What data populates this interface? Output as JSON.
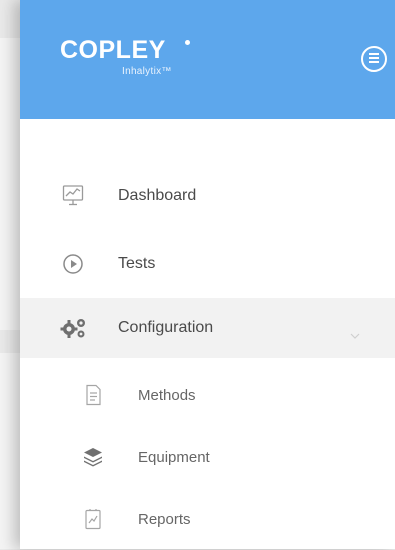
{
  "header": {
    "logo_title": "COPLEY",
    "logo_subtitle": "Inhalytix™"
  },
  "nav": {
    "items": [
      {
        "label": "Dashboard",
        "icon": "dashboard-chart-icon"
      },
      {
        "label": "Tests",
        "icon": "play-circle-icon"
      },
      {
        "label": "Configuration",
        "icon": "gears-icon",
        "expanded": true
      }
    ],
    "subitems": [
      {
        "label": "Methods",
        "icon": "document-icon"
      },
      {
        "label": "Equipment",
        "icon": "layers-icon"
      },
      {
        "label": "Reports",
        "icon": "report-chart-icon"
      }
    ]
  },
  "colors": {
    "header_bg": "#5da7ec",
    "active_row_bg": "#f2f2f2",
    "icon_color": "#9a9a9a"
  }
}
